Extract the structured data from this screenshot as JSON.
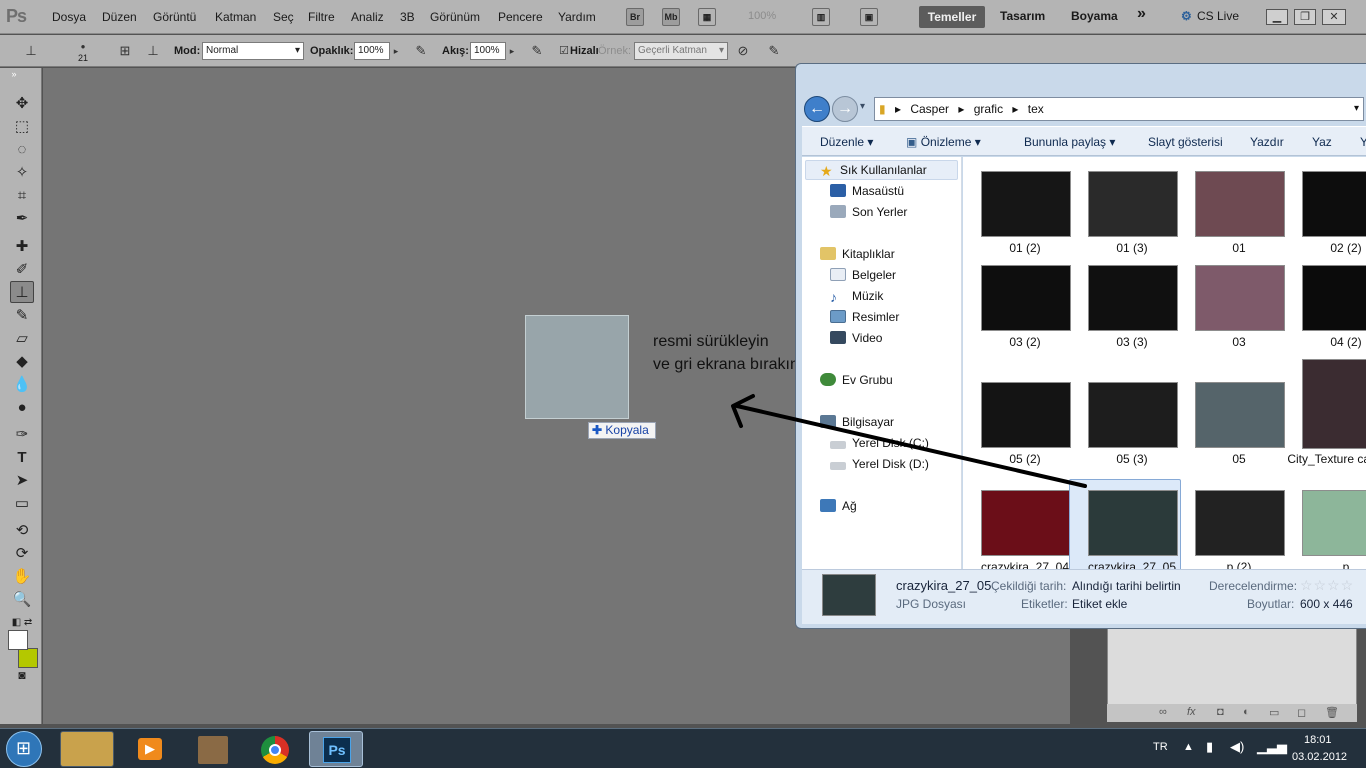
{
  "app": {
    "logo": "Ps"
  },
  "menu": [
    "Dosya",
    "Düzen",
    "Görüntü",
    "Katman",
    "Seç",
    "Filtre",
    "Analiz",
    "3B",
    "Görünüm",
    "Pencere",
    "Yardım"
  ],
  "menu_buttons": {
    "br": "Br",
    "mb": "Mb",
    "zoom": "100%"
  },
  "workspaces": {
    "active": "Temeller",
    "items": [
      "Tasarım",
      "Boyama"
    ],
    "more": "»",
    "cslive": "CS Live"
  },
  "options": {
    "brush_size": "21",
    "mode_label": "Mod:",
    "mode_value": "Normal",
    "opacity_label": "Opaklık:",
    "opacity_value": "100%",
    "flow_label": "Akış:",
    "flow_value": "100%",
    "aligned_label": "Hizalı",
    "sample_label": "Örnek:",
    "sample_value": "Geçerli Katman"
  },
  "canvas": {
    "annotation_line1": "resmi sürükleyin",
    "annotation_line2": "ve gri ekrana bırakın",
    "copy_badge": "Kopyala"
  },
  "explorer": {
    "breadcrumb": [
      "Casper",
      "grafic",
      "tex"
    ],
    "toolbar": [
      {
        "label": "Düzenle",
        "dropdown": true
      },
      {
        "label": "Önizleme",
        "dropdown": true
      },
      {
        "label": "Bununla paylaş",
        "dropdown": true
      },
      {
        "label": "Slayt gösterisi"
      },
      {
        "label": "Yazdır"
      },
      {
        "label": "Yaz"
      },
      {
        "label": "Y"
      }
    ],
    "nav": {
      "favorites": "Sık Kullanılanlar",
      "desktop": "Masaüstü",
      "recent": "Son Yerler",
      "libraries": "Kitaplıklar",
      "documents": "Belgeler",
      "music": "Müzik",
      "pictures": "Resimler",
      "video": "Video",
      "homegroup": "Ev Grubu",
      "computer": "Bilgisayar",
      "disk_c": "Yerel Disk (C:)",
      "disk_d": "Yerel Disk (D:)",
      "network": "Ağ"
    },
    "files": [
      {
        "name": "01 (2)"
      },
      {
        "name": "01 (3)"
      },
      {
        "name": "01"
      },
      {
        "name": "02 (2)"
      },
      {
        "name": "03 (2)"
      },
      {
        "name": "03 (3)"
      },
      {
        "name": "03"
      },
      {
        "name": "04 (2)"
      },
      {
        "name": "05 (2)"
      },
      {
        "name": "05 (3)"
      },
      {
        "name": "05"
      },
      {
        "name": "City_Texture camiluch"
      },
      {
        "name": "crazykira_27_04"
      },
      {
        "name": "crazykira_27_05",
        "selected": true
      },
      {
        "name": "p (2)"
      },
      {
        "name": "p"
      }
    ],
    "details": {
      "filename": "crazykira_27_05",
      "filetype": "JPG Dosyası",
      "date_label": "Çekildiği tarih:",
      "date_value": "Alındığı tarihi belirtin",
      "tags_label": "Etiketler:",
      "tags_value": "Etiket ekle",
      "rating_label": "Derecelendirme:",
      "size_label": "Boyutlar:",
      "size_value": "600 x 446"
    }
  },
  "taskbar": {
    "language": "TR",
    "time": "18:01",
    "date": "03.02.2012"
  }
}
